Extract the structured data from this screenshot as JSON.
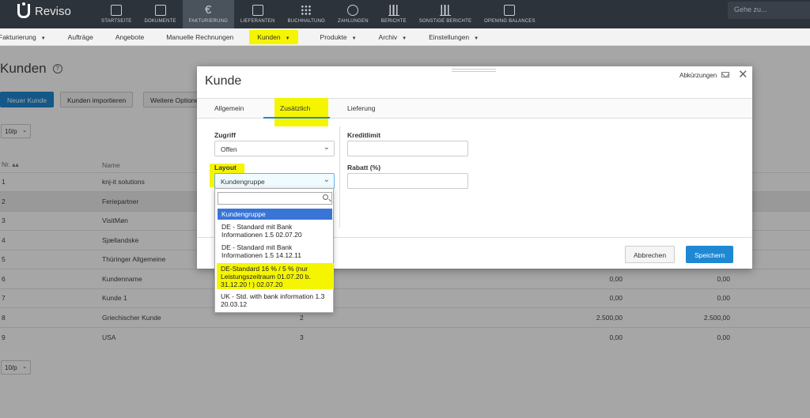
{
  "topnav": {
    "brand": "Reviso",
    "items": [
      {
        "label": "STARTSEITE",
        "icon": "home-icon"
      },
      {
        "label": "DOKUMENTE",
        "icon": "folder-icon"
      },
      {
        "label": "FAKTURIERUNG",
        "icon": "euro-icon",
        "active": true
      },
      {
        "label": "LIEFERANTEN",
        "icon": "truck-icon"
      },
      {
        "label": "BUCHHALTUNG",
        "icon": "grid-icon"
      },
      {
        "label": "ZAHLUNGEN",
        "icon": "database-icon"
      },
      {
        "label": "BERICHTE",
        "icon": "bar-chart-icon"
      },
      {
        "label": "SONSTIGE BERICHTE",
        "icon": "bar-chart-icon"
      },
      {
        "label": "OPENING BALANCES",
        "icon": "bookmark-icon"
      }
    ],
    "search_placeholder": "Gehe zu..."
  },
  "subnav": {
    "items": [
      "Fakturierung",
      "Aufträge",
      "Angebote",
      "Manuelle Rechnungen",
      "Kunden",
      "Produkte",
      "Archiv",
      "Einstellungen"
    ]
  },
  "page": {
    "title": "Kunden",
    "new_button": "Neuer Kunde",
    "import_button": "Kunden importieren",
    "more_button": "Weitere Optionen",
    "page_size": "10/p",
    "columns": {
      "nr": "Nr.",
      "name": "Name"
    },
    "rows": [
      {
        "nr": "1",
        "name": "knj-it solutions",
        "c3": "",
        "c4": "",
        "c5": ""
      },
      {
        "nr": "2",
        "name": "Feriepartner",
        "c3": "",
        "c4": "",
        "c5": ""
      },
      {
        "nr": "3",
        "name": "VisitMøn",
        "c3": "",
        "c4": "",
        "c5": ""
      },
      {
        "nr": "4",
        "name": "Sjællandske",
        "c3": "",
        "c4": "",
        "c5": ""
      },
      {
        "nr": "5",
        "name": "Thüringer Allgemeine",
        "c3": "",
        "c4": "",
        "c5": ""
      },
      {
        "nr": "6",
        "name": "Kundenname",
        "c3": "",
        "c4": "0,00",
        "c5": "0,00"
      },
      {
        "nr": "7",
        "name": "Kunde 1",
        "c3": "",
        "c4": "0,00",
        "c5": "0,00"
      },
      {
        "nr": "8",
        "name": "Griechischer Kunde",
        "c3": "2",
        "c4": "2.500,00",
        "c5": "2.500,00"
      },
      {
        "nr": "9",
        "name": "USA",
        "c3": "3",
        "c4": "0,00",
        "c5": "0,00"
      }
    ]
  },
  "modal": {
    "title": "Kunde",
    "abbreviations": "Abkürzungen",
    "tabs": [
      "Allgemein",
      "Zusätzlich",
      "Lieferung"
    ],
    "fields": {
      "zugriff_label": "Zugriff",
      "zugriff_value": "Offen",
      "layout_label": "Layout",
      "layout_value": "Kundengruppe",
      "kreditlimit_label": "Kreditlimit",
      "kreditlimit_value": "",
      "rabatt_label": "Rabatt (%)",
      "rabatt_value": ""
    },
    "cancel": "Abbrechen",
    "save": "Speichern"
  },
  "dropdown": {
    "search_value": "",
    "options": [
      "Kundengruppe",
      "DE - Standard mit Bank Informationen 1.5 02.07.20",
      "DE - Standard mit Bank Informationen 1.5 14.12.11",
      "DE-Standard 16 % / 5 % (nur Leistungszeitraum 01.07.20 b. 31.12.20 ! ) 02.07.20",
      "UK - Std. with bank information 1.3 20.03.12"
    ]
  },
  "colors": {
    "accent": "#1e88d2",
    "highlight": "#f5f500",
    "topbar": "#2d333b"
  }
}
